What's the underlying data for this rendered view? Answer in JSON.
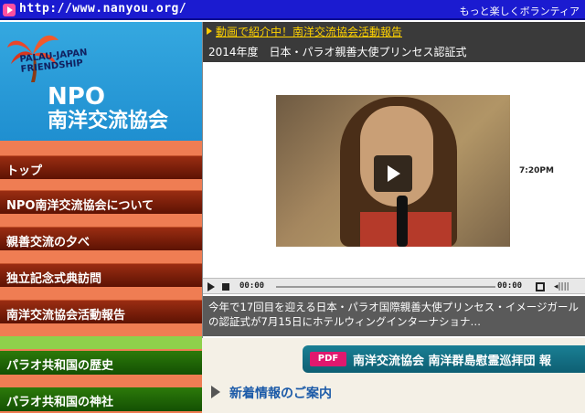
{
  "topbar": {
    "url": "http://www.nanyou.org/",
    "tagline": "もっと楽しくボランティア"
  },
  "logo": {
    "arc_line1": "PALAU-JAPAN",
    "arc_line2": "FRIENDSHIP",
    "npo": "NPO",
    "org_name": "南洋交流協会"
  },
  "nav": {
    "items": [
      {
        "label": "トップ"
      },
      {
        "label": "NPO南洋交流協会について"
      },
      {
        "label": "親善交流の夕べ"
      },
      {
        "label": "独立記念式典訪問"
      },
      {
        "label": "南洋交流協会活動報告"
      }
    ],
    "green_items": [
      {
        "label": "パラオ共和国の歴史"
      },
      {
        "label": "パラオ共和国の神社"
      }
    ]
  },
  "video": {
    "header_link": "動画で紹介中！南洋交流協会活動報告",
    "header_title": "2014年度　日本・パラオ親善大使プリンセス認証式",
    "side_time": "7:20PM",
    "time_current": "00:00",
    "time_total": "00:00",
    "description": "今年で17回目を迎える日本・パラオ国際親善大使プリンセス・イメージガールの認証式が7月15日にホテルウィングインターナショナ…"
  },
  "pdf_banner": {
    "badge": "PDF",
    "text": "南洋交流協会 南洋群島慰霊巡拝団 報"
  },
  "news": {
    "heading": "新着情報のご案内"
  }
}
